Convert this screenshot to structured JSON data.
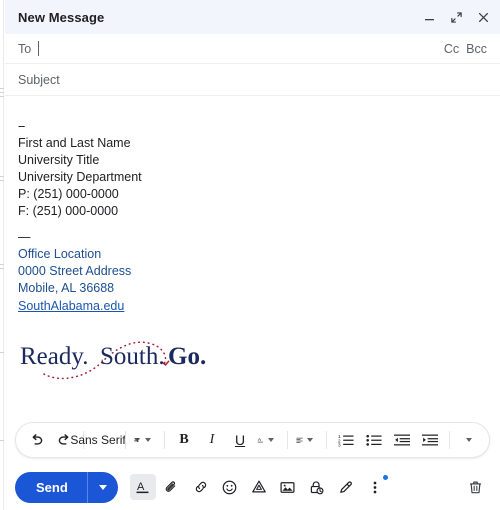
{
  "window": {
    "title": "New Message",
    "controls": [
      {
        "name": "minimize",
        "icon": "minimize-icon"
      },
      {
        "name": "expand",
        "icon": "expand-icon"
      },
      {
        "name": "close",
        "icon": "close-icon"
      }
    ]
  },
  "fields": {
    "to_label": "To",
    "to_value": "",
    "cc_label": "Cc",
    "bcc_label": "Bcc",
    "subject_placeholder": "Subject",
    "subject_value": ""
  },
  "signature": {
    "separator_top": "--",
    "name": "First and Last Name",
    "title": "University Title",
    "department": "University Department",
    "phone": "P: (251) 000-0000",
    "fax": "F: (251) 000-0000",
    "separator_mid": "—",
    "office": "Office Location",
    "street": "0000 Street Address",
    "city_state_zip": "Mobile, AL 36688",
    "website": "SouthAlabama.edu",
    "logo": {
      "word1": "Ready.",
      "word2": "South.",
      "word3": "Go.",
      "navy": "#1b2a5e",
      "swoosh_color": "#a6192e",
      "alt": "Ready. South. Go."
    }
  },
  "format_toolbar": {
    "undo": "undo-icon",
    "redo": "redo-icon",
    "font_family": "Sans Serif",
    "font_size": "font-size-icon",
    "bold": "B",
    "italic": "I",
    "underline": "U",
    "text_color": "A",
    "align": "align-icon",
    "numbered_list": "numbered-list-icon",
    "bulleted_list": "bulleted-list-icon",
    "indent_less": "indent-less-icon",
    "indent_more": "indent-more-icon",
    "more": "more-format-icon"
  },
  "bottom_bar": {
    "send_label": "Send",
    "send_options": "send-options-icon",
    "icons": [
      {
        "name": "formatting-options-icon",
        "label": "A",
        "active": true
      },
      {
        "name": "attach-file-icon",
        "label": "",
        "active": false
      },
      {
        "name": "insert-link-icon",
        "label": "",
        "active": false
      },
      {
        "name": "insert-emoji-icon",
        "label": "",
        "active": false
      },
      {
        "name": "insert-drive-file-icon",
        "label": "",
        "active": false
      },
      {
        "name": "insert-photo-icon",
        "label": "",
        "active": false
      },
      {
        "name": "confidential-mode-icon",
        "label": "",
        "active": false
      },
      {
        "name": "insert-signature-icon",
        "label": "",
        "active": false
      },
      {
        "name": "more-options-icon",
        "label": "",
        "active": false
      }
    ],
    "discard": "delete-draft-icon"
  },
  "colors": {
    "header_bg": "#f2f6fc",
    "send_blue": "#1a56d6",
    "link_blue": "#1a56b0",
    "sig_blue": "#1d4f91",
    "text": "#202124",
    "muted": "#5f6368"
  }
}
